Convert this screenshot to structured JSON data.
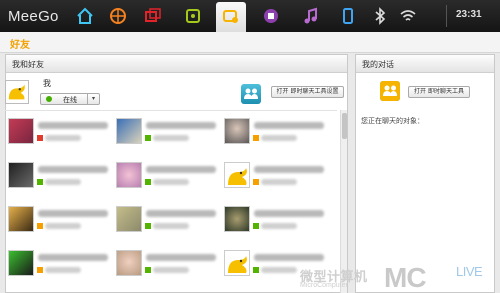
{
  "topbar": {
    "brand": "MeeGo",
    "clock": "23:31",
    "icons": [
      "home-icon",
      "globe-icon",
      "windows-icon",
      "apps-icon",
      "people-icon",
      "media-icon",
      "music-icon",
      "device-icon",
      "bluetooth-icon",
      "wifi-icon"
    ],
    "active_icon": "people-icon"
  },
  "app": {
    "title": "好友"
  },
  "left_panel": {
    "header": "我和好友",
    "me": {
      "name": "我",
      "status": "在线",
      "open_button": "打开 即时聊天工具设置"
    }
  },
  "right_panel": {
    "header": "我的对话",
    "open_button": "打开 即时聊天工具",
    "chatting_label": "您正在聊天的对象："
  },
  "watermark": {
    "name_cn": "微型计算机",
    "name_en": "MicroComputer",
    "logo": "MC",
    "logo_suffix": "LIVE"
  },
  "colors": {
    "accent": "#f2a100",
    "online": "#43b000",
    "topbar": "#1d1d1d"
  }
}
